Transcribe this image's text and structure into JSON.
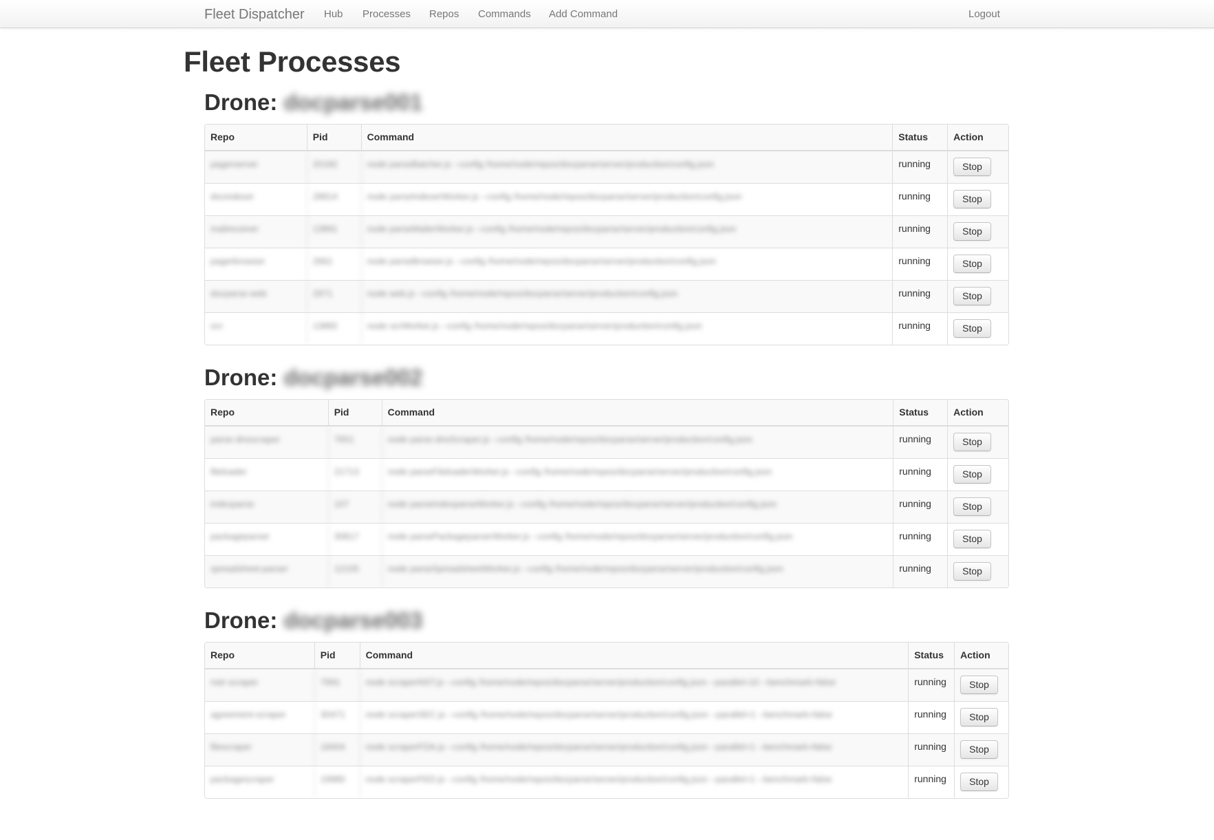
{
  "navbar": {
    "brand": "Fleet Dispatcher",
    "items": [
      {
        "label": "Hub"
      },
      {
        "label": "Processes"
      },
      {
        "label": "Repos"
      },
      {
        "label": "Commands"
      },
      {
        "label": "Add Command"
      }
    ],
    "logout": "Logout"
  },
  "page": {
    "title": "Fleet Processes"
  },
  "drone_prefix": "Drone:",
  "columns": [
    "Repo",
    "Pid",
    "Command",
    "Status",
    "Action"
  ],
  "drones": [
    {
      "name": "docparse001",
      "rows": [
        {
          "repo": "pagerserver",
          "pid": "20182",
          "command": "node parseBatcher.js --config /home/node/repos/docparse/server/production/config.json",
          "status": "running",
          "action": "Stop"
        },
        {
          "repo": "docindexer",
          "pid": "28814",
          "command": "node parseIndexerWorker.js --config /home/node/repos/docparse/server/production/config.json",
          "status": "running",
          "action": "Stop"
        },
        {
          "repo": "mailreceiver",
          "pid": "13891",
          "command": "node parseMailerWorker.js --config /home/node/repos/docparse/server/production/config.json",
          "status": "running",
          "action": "Stop"
        },
        {
          "repo": "pagerbrowser",
          "pid": "2661",
          "command": "node parseBrowser.js --config /home/node/repos/docparse/server/production/config.json",
          "status": "running",
          "action": "Stop"
        },
        {
          "repo": "docparse-web",
          "pid": "2971",
          "command": "node web.js --config /home/node/repos/docparse/server/production/config.json",
          "status": "running",
          "action": "Stop"
        },
        {
          "repo": "ocr",
          "pid": "13882",
          "command": "node ocrWorker.js --config /home/node/repos/docparse/server/production/config.json",
          "status": "running",
          "action": "Stop"
        }
      ]
    },
    {
      "name": "docparse002",
      "rows": [
        {
          "repo": "parse-dnsscraper",
          "pid": "7651",
          "command": "node parse-dnsScraper.js --config /home/node/repos/docparse/server/production/config.json",
          "status": "running",
          "action": "Stop"
        },
        {
          "repo": "fileloader",
          "pid": "21713",
          "command": "node parseFileloaderWorker.js --config /home/node/repos/docparse/server/production/config.json",
          "status": "running",
          "action": "Stop"
        },
        {
          "repo": "indexparse",
          "pid": "107",
          "command": "node parseIndexparseWorker.js --config /home/node/repos/docparse/server/production/config.json",
          "status": "running",
          "action": "Stop"
        },
        {
          "repo": "packageparser",
          "pid": "30817",
          "command": "node parsePackageparserWorker.js --config /home/node/repos/docparse/server/production/config.json",
          "status": "running",
          "action": "Stop"
        },
        {
          "repo": "spreadsheet-parser",
          "pid": "12105",
          "command": "node parseSpreadsheetWorker.js --config /home/node/repos/docparse/server/production/config.json",
          "status": "running",
          "action": "Stop"
        }
      ]
    },
    {
      "name": "docparse003",
      "rows": [
        {
          "repo": "nstr-scraper",
          "pid": "7991",
          "command": "node scraperNST.js --config /home/node/repos/docparse/server/production/config.json --parallel=10 --benchmark=false",
          "status": "running",
          "action": "Stop"
        },
        {
          "repo": "agreement-scraper",
          "pid": "30471",
          "command": "node scraperSEC.js --config /home/node/repos/docparse/server/production/config.json --parallel=1 --benchmark=false",
          "status": "running",
          "action": "Stop"
        },
        {
          "repo": "filescraper",
          "pid": "18404",
          "command": "node scraperFDA.js --config /home/node/repos/docparse/server/production/config.json --parallel=1 --benchmark=false",
          "status": "running",
          "action": "Stop"
        },
        {
          "repo": "packagescraper",
          "pid": "19980",
          "command": "node scraperFED.js --config /home/node/repos/docparse/server/production/config.json --parallel=1 --benchmark=false",
          "status": "running",
          "action": "Stop"
        }
      ]
    }
  ]
}
